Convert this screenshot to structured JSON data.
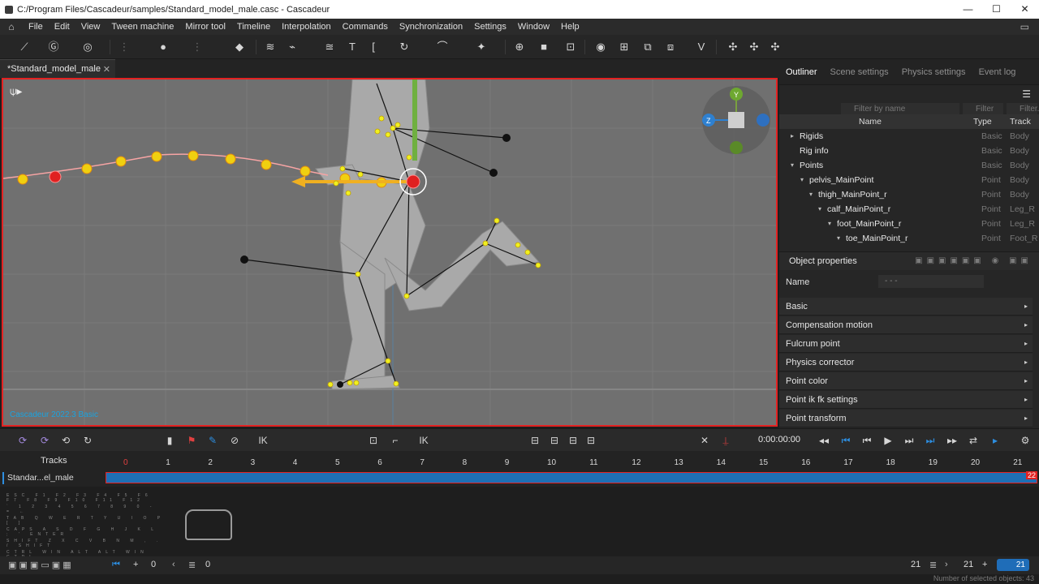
{
  "window": {
    "title": "C:/Program Files/Cascadeur/samples/Standard_model_male.casc - Cascadeur",
    "minimize": "—",
    "maximize": "☐",
    "close": "✕"
  },
  "menu": [
    "File",
    "Edit",
    "View",
    "Tween machine",
    "Mirror tool",
    "Timeline",
    "Interpolation",
    "Commands",
    "Synchronization",
    "Settings",
    "Window",
    "Help"
  ],
  "document_tab": {
    "label": "*Standard_model_male",
    "close": "✕"
  },
  "viewport": {
    "watermark": "Cascadeur 2022.3 Basic",
    "gizmo": {
      "y": "Y",
      "z": "Z"
    }
  },
  "right_tabs": [
    "Outliner",
    "Scene settings",
    "Physics settings",
    "Event log"
  ],
  "outliner": {
    "filter_name_placeholder": "Filter by name",
    "filter_b_placeholder": "Filter b...",
    "filter_c_placeholder": "Filter...",
    "columns": {
      "name": "Name",
      "type": "Type",
      "track": "Track"
    },
    "rows": [
      {
        "name": "Rigids",
        "type": "Basic",
        "track": "Body",
        "arrow": "▸"
      },
      {
        "name": "Rig info",
        "type": "Basic",
        "track": "Body",
        "arrow": ""
      },
      {
        "name": "Points",
        "type": "Basic",
        "track": "Body",
        "arrow": "▾"
      },
      {
        "name": "pelvis_MainPoint",
        "type": "Point",
        "track": "Body",
        "arrow": "▾"
      },
      {
        "name": "thigh_MainPoint_r",
        "type": "Point",
        "track": "Body",
        "arrow": "▾"
      },
      {
        "name": "calf_MainPoint_r",
        "type": "Point",
        "track": "Leg_R",
        "arrow": "▾"
      },
      {
        "name": "foot_MainPoint_r",
        "type": "Point",
        "track": "Leg_R",
        "arrow": "▾"
      },
      {
        "name": "toe_MainPoint_r",
        "type": "Point",
        "track": "Foot_R",
        "arrow": "▾"
      }
    ]
  },
  "object_properties": {
    "title": "Object properties",
    "name_label": "Name",
    "name_value": "- - -",
    "sections": [
      "Basic",
      "Compensation motion",
      "Fulcrum point",
      "Physics corrector",
      "Point color",
      "Point ik fk settings",
      "Point transform"
    ]
  },
  "playback": {
    "timecode": "0:00:00:00",
    "ik_label": "IK"
  },
  "timeline": {
    "tracks_label": "Tracks",
    "track_name": "Standar...el_male",
    "ticks": [
      "0",
      "1",
      "2",
      "3",
      "4",
      "5",
      "6",
      "7",
      "8",
      "9",
      "10",
      "11",
      "12",
      "13",
      "14",
      "15",
      "16",
      "17",
      "18",
      "19",
      "20",
      "21"
    ],
    "end_frame": "22"
  },
  "status": {
    "left_frame": "0",
    "left_frame2": "0",
    "right_frame": "21",
    "right_frame2": "21",
    "current_frame_btn": "21",
    "selected_objects": "Number of selected objects: 43"
  },
  "colors": {
    "accent_blue": "#1e6fb5",
    "selection_red": "#e32222",
    "point_yellow": "#f0e020",
    "viewport_bg": "#707070"
  }
}
